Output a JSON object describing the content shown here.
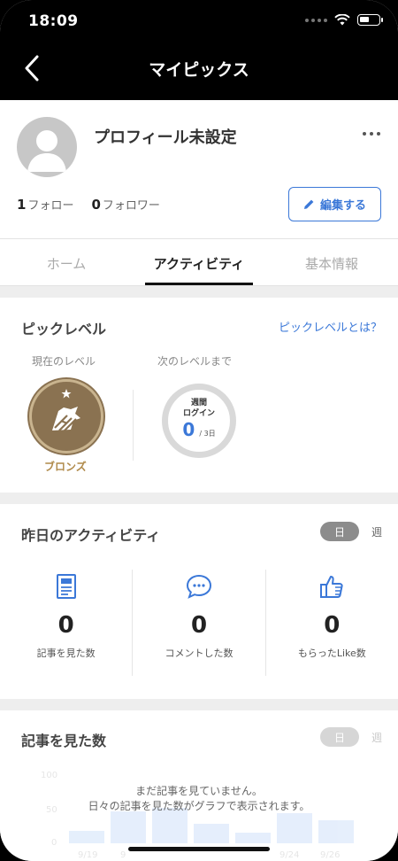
{
  "status_bar": {
    "time": "18:09"
  },
  "nav": {
    "title": "マイピックス",
    "back_icon": "chevron-left-icon"
  },
  "profile": {
    "name": "プロフィール未設定",
    "follow_count": "1",
    "follow_label": "フォロー",
    "follower_count": "0",
    "follower_label": "フォロワー",
    "edit_label": "編集する"
  },
  "tabs": [
    {
      "label": "ホーム",
      "active": false
    },
    {
      "label": "アクティビティ",
      "active": true
    },
    {
      "label": "基本情報",
      "active": false
    }
  ],
  "pick_level": {
    "title": "ピックレベル",
    "link": "ピックレベルとは？",
    "current_label": "現在のレベル",
    "current_level": "ブロンズ",
    "next_label": "次のレベルまで",
    "ring_line1": "週間",
    "ring_line2": "ログイン",
    "ring_value": "0",
    "ring_unit": "/ 3日"
  },
  "yesterday_activity": {
    "title": "昨日のアクティビティ",
    "toggle_day": "日",
    "toggle_week": "週",
    "stats": [
      {
        "icon": "article-icon",
        "value": "0",
        "label": "記事を見た数"
      },
      {
        "icon": "comment-icon",
        "value": "0",
        "label": "コメントした数"
      },
      {
        "icon": "thumbs-up-icon",
        "value": "0",
        "label": "もらったLike数"
      }
    ]
  },
  "viewed_chart": {
    "title": "記事を見た数",
    "toggle_day": "日",
    "toggle_week": "週",
    "empty_line1": "まだ記事を見ていません。",
    "empty_line2": "日々の記事を見た数がグラフで表示されます。",
    "y_ticks": [
      "100",
      "50",
      "0"
    ],
    "x_ticks": [
      "9/19",
      "9",
      "9/24",
      "9/26"
    ]
  },
  "colors": {
    "accent": "#3b78d8",
    "bronze": "#8a7251",
    "bronze_text": "#b08a4a"
  }
}
